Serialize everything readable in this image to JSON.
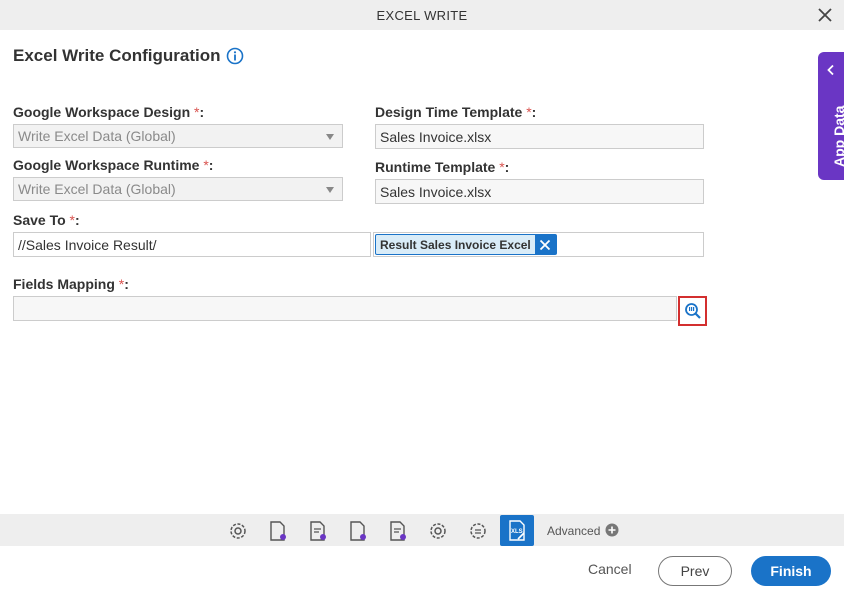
{
  "window": {
    "title": "EXCEL WRITE"
  },
  "heading": "Excel Write Configuration",
  "required_mark": "*",
  "form": {
    "design_label": "Google Workspace Design",
    "design_value": "Write Excel Data (Global)",
    "runtime_label": "Google Workspace Runtime",
    "runtime_value": "Write Excel Data (Global)",
    "design_template_label": "Design Time Template",
    "design_template_value": "Sales Invoice.xlsx",
    "runtime_template_label": "Runtime Template",
    "runtime_template_value": "Sales Invoice.xlsx",
    "save_to_label": "Save To",
    "save_to_path": "//Sales Invoice Result/",
    "save_to_chip": "Result Sales Invoice Excel",
    "fields_mapping_label": "Fields Mapping",
    "fields_mapping_value": ""
  },
  "app_data_tab": {
    "label": "App Data"
  },
  "toolbar": {
    "icons": [
      "gear-icon",
      "document-gear-icon",
      "form-gear-icon",
      "document-gear-icon",
      "form-gear-icon",
      "gear-icon",
      "cog-list-icon",
      "xls-edit-icon"
    ],
    "active_icon": "xls-edit-icon",
    "active_icon_text": "XLS",
    "advanced_label": "Advanced"
  },
  "footer": {
    "cancel_label": "Cancel",
    "prev_label": "Prev",
    "finish_label": "Finish"
  },
  "colors": {
    "accent": "#1a73c8",
    "app_data_tab": "#6a36c4",
    "required": "#d9534f",
    "highlight_border": "#d32f2f"
  }
}
